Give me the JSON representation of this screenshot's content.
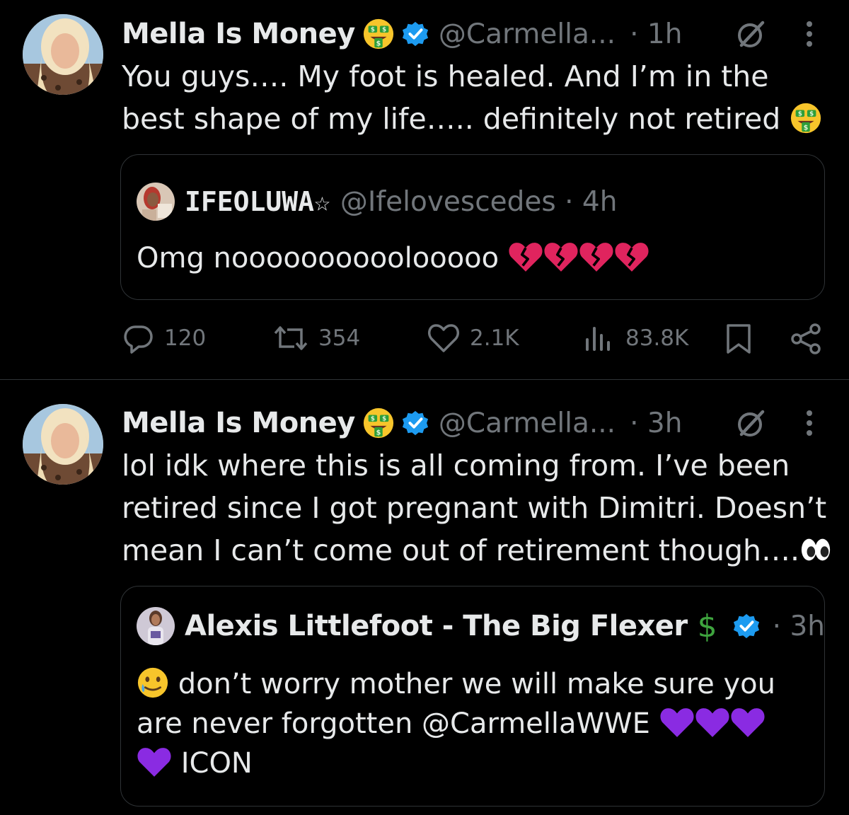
{
  "tweet1": {
    "author": "Mella Is Money",
    "handle": "@Carmella...",
    "time": "· 1h",
    "text_line1": "You guys…. My foot is healed. And I’m in the",
    "text_line2": "best shape of my life….. definitely not retired",
    "quote": {
      "author": "IFEOLUWA☆",
      "handle": "@Ifelovescedes · 4h",
      "text": "Omg noooooooooolooooo"
    },
    "stats": {
      "replies": "120",
      "reposts": "354",
      "likes": "2.1K",
      "views": "83.8K"
    }
  },
  "tweet2": {
    "author": "Mella Is Money",
    "handle": "@Carmella...",
    "time": "· 3h",
    "text_line1": "lol idk where this is all coming from. I’ve been",
    "text_line2": "retired since I got pregnant with Dimitri. Doesn’t",
    "text_line3": "mean I can’t come out of retirement though….",
    "quote": {
      "author": "Alexis Littlefoot - The Big Flexer",
      "author_symbol": "$",
      "time": "· 3h",
      "text_line1": "don’t worry mother we will make sure you",
      "text_line2": "are never forgotten @CarmellaWWE",
      "text_line3": "ICON"
    }
  },
  "colors": {
    "background": "#000000",
    "text": "#e7e9ea",
    "muted": "#71767b",
    "verified": "#1d9bf0",
    "broken_heart": "#e0245e",
    "purple_heart": "#8a2be2",
    "border": "#2f3336"
  },
  "icons": [
    "money-mouth-face-emoji",
    "verified-badge-icon",
    "grok-icon",
    "more-icon",
    "reply-icon",
    "repost-icon",
    "like-icon",
    "views-icon",
    "bookmark-icon",
    "share-icon",
    "broken-heart-emoji",
    "purple-heart-emoji",
    "eyes-emoji",
    "tear-smile-emoji"
  ]
}
